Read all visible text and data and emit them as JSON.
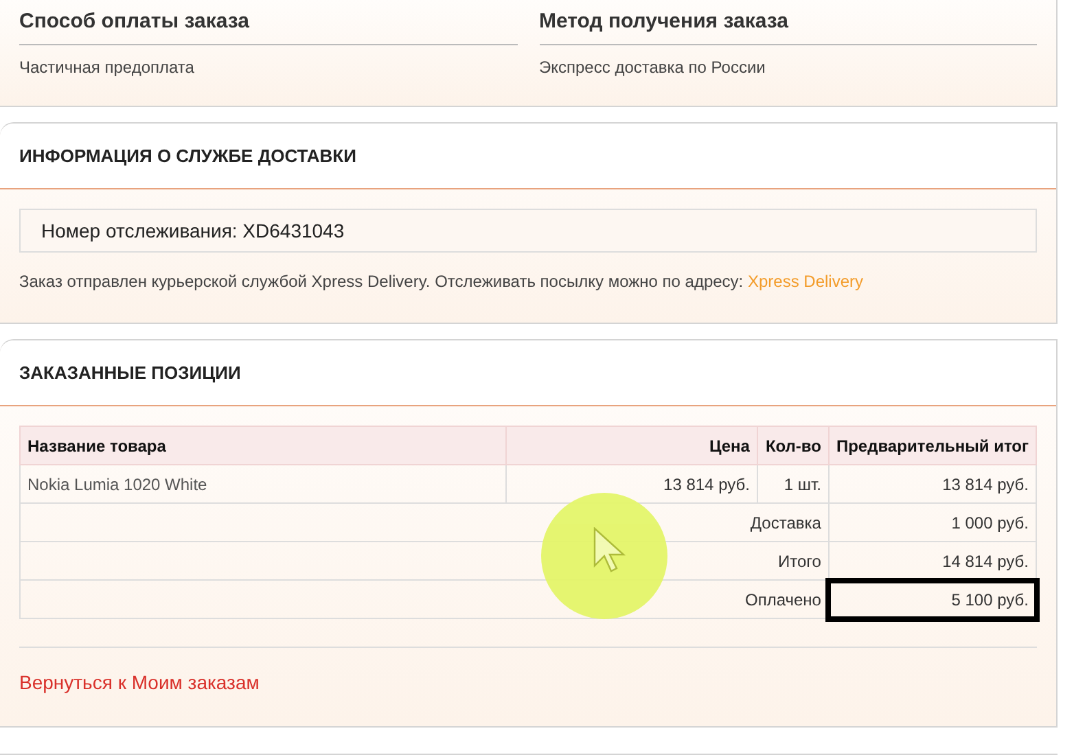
{
  "order_info": {
    "columns": [
      {
        "heading": "Способ оплаты заказа",
        "value": "Частичная предоплата"
      },
      {
        "heading": "Метод получения заказа",
        "value": "Экспресс доставка по России"
      }
    ]
  },
  "delivery": {
    "title": "ИНФОРМАЦИЯ О СЛУЖБЕ ДОСТАВКИ",
    "tracking": "Номер отслеживания: XD6431043",
    "note": "Заказ отправлен курьерской службой Xpress Delivery. Отслеживать посылку можно по адресу:",
    "link": "Xpress Delivery"
  },
  "items": {
    "title": "ЗАКАЗАННЫЕ ПОЗИЦИИ",
    "table": {
      "columns": [
        "Название товара",
        "Цена",
        "Кол-во",
        "Предварительный итог"
      ],
      "rows": [
        [
          "Nokia Lumia 1020 White",
          "13 814 руб.",
          "1 шт.",
          "13 814 руб."
        ]
      ],
      "totals": [
        {
          "label": "Доставка",
          "value": "1 000 руб.",
          "highlighted": false
        },
        {
          "label": "Итого",
          "value": "14 814 руб.",
          "highlighted": false
        },
        {
          "label": "Оплачено",
          "value": "5 100 руб.",
          "highlighted": true
        }
      ]
    },
    "back_link": "Вернуться к Моим заказам"
  },
  "cursor": {
    "kind": "highlight"
  }
}
